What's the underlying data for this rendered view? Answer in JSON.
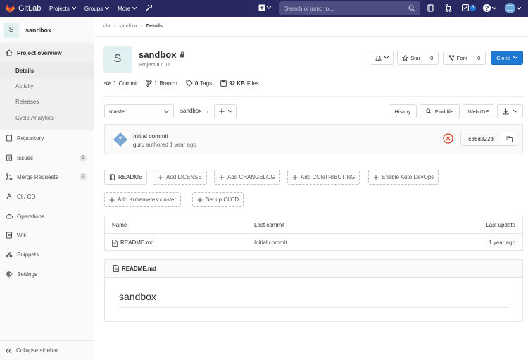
{
  "navbar": {
    "brand": "GitLab",
    "links": [
      "Projects",
      "Groups",
      "More"
    ],
    "search_placeholder": "Search or jump to...",
    "todo_count": "8",
    "colors": {
      "bar": "#292961",
      "logo": "#e24329"
    }
  },
  "sidebar": {
    "project_initial": "S",
    "project_name": "sandbox",
    "overview": "Project overview",
    "sub_items": [
      "Details",
      "Activity",
      "Releases",
      "Cycle Analytics"
    ],
    "items": [
      {
        "label": "Repository",
        "icon": "book-icon"
      },
      {
        "label": "Issues",
        "icon": "issues-icon",
        "count": "2"
      },
      {
        "label": "Merge Requests",
        "icon": "merge-request-icon",
        "count": "0"
      },
      {
        "label": "CI / CD",
        "icon": "rocket-icon"
      },
      {
        "label": "Operations",
        "icon": "cloud-gear-icon"
      },
      {
        "label": "Wiki",
        "icon": "book-open-icon"
      },
      {
        "label": "Snippets",
        "icon": "scissors-icon"
      },
      {
        "label": "Settings",
        "icon": "gear-icon"
      }
    ],
    "collapse": "Collapse sidebar"
  },
  "breadcrumb": {
    "group": "riht",
    "project": "sandbox",
    "current": "Details"
  },
  "project": {
    "initial": "S",
    "name": "sandbox",
    "id_text": "Project ID: 11",
    "star_label": "Star",
    "star_count": "0",
    "fork_label": "Fork",
    "fork_count": "0",
    "clone_label": "Clone"
  },
  "stats": {
    "commits_num": "1",
    "commits_label": "Commit",
    "branches_num": "1",
    "branches_label": "Branch",
    "tags_num": "0",
    "tags_label": "Tags",
    "files_size": "92 KB",
    "files_label": "Files"
  },
  "repo_nav": {
    "branch": "master",
    "path": "sandbox",
    "path_sep": "/",
    "history": "History",
    "find_file": "Find file",
    "web_ide": "Web IDE"
  },
  "last_commit": {
    "title": "Initial commit",
    "author": "guru",
    "meta": "authored 1 year ago",
    "sha": "e86d322d"
  },
  "quick_actions": [
    "README",
    "Add LICENSE",
    "Add CHANGELOG",
    "Add CONTRIBUTING",
    "Enable Auto DevOps",
    "Add Kubernetes cluster",
    "Set up CI/CD"
  ],
  "file_table": {
    "headers": {
      "name": "Name",
      "last_commit": "Last commit",
      "last_update": "Last update"
    },
    "rows": [
      {
        "name": "README.md",
        "commit": "Initial commit",
        "updated": "1 year ago"
      }
    ]
  },
  "readme": {
    "file": "README.md",
    "heading": "sandbox"
  }
}
